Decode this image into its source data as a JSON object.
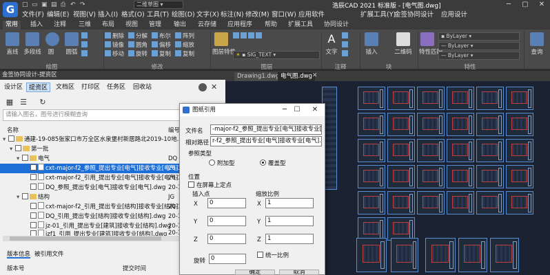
{
  "app": {
    "title": "浩辰CAD 2021 标准版 - [电气图.dwg]",
    "workspace": "二维草图",
    "brand_color": "#2f6fd0",
    "menu": [
      "文件(F)",
      "编辑(E)",
      "视图(V)",
      "插入(I)",
      "格式(O)",
      "工具(T)",
      "绘图(D)",
      "文字(X)",
      "标注(N)",
      "修改(M)",
      "窗口(W)",
      "应用软件",
      "扩展工具(Y)",
      "金签协同设计",
      "应用设计"
    ]
  },
  "ribbon": {
    "tabs": [
      "常用",
      "插入",
      "注释",
      "三维",
      "布局",
      "视图",
      "管理",
      "输出",
      "云存储",
      "应用程序",
      "帮助",
      "扩展工具",
      "协同设计"
    ],
    "draw": {
      "line": "直线",
      "polyline": "多段线",
      "circle": "圆",
      "arc": "圆弧",
      "group": "绘图"
    },
    "modify": {
      "delete": "删除",
      "explode": "分解",
      "boolean": "布尔",
      "copy": "复制",
      "mirror": "镜像",
      "fillet": "圆角",
      "offset": "偏移",
      "array": "阵列",
      "scale": "缩放",
      "move": "移动",
      "rotate": "旋转",
      "stretch": "复制",
      "group": "修改"
    },
    "layer": {
      "props": "图层特性",
      "name": "SIG_TEXT",
      "group": "图层"
    },
    "annotation": {
      "text": "文字",
      "group": "注释"
    },
    "block": {
      "insert": "插入",
      "qrcode": "二维码",
      "group": "块"
    },
    "properties": {
      "match": "特性匹配",
      "bylayer1": "ByLayer",
      "bylayer2": "ByLayer",
      "bylayer3": "ByLayer",
      "group": "特性"
    },
    "utilities": {
      "query": "查询"
    }
  },
  "left_panel": {
    "title": "金签协同设计-提资区",
    "tabs": [
      "设计区",
      "提资区",
      "文档区",
      "打印区",
      "任务区",
      "回收站"
    ],
    "active_tab": "提资区",
    "search_placeholder": "请输入图名，图号进行模糊查询",
    "col_name": "名称",
    "col_num": "编号",
    "tree": [
      {
        "label": "通建-19-085张家口市万全区水泉堡村新居路北2019-10地...",
        "num": "",
        "level": 0
      },
      {
        "label": "第一批",
        "num": "",
        "level": 1
      },
      {
        "label": "电气",
        "num": "DQ",
        "level": 2
      },
      {
        "label": "cxt-major-f2_参照_提出专业[电气]接收专业[电气]",
        "num": "20-1",
        "level": 3,
        "selected": true
      },
      {
        "label": "cxt-major-f2_引用_提出专业[电气]接收专业[电气]",
        "num": "20-1",
        "level": 3
      },
      {
        "label": "DQ_参照_提出专业[电气]接收专业[电气].dwg",
        "num": "20-1",
        "level": 3
      },
      {
        "label": "结构",
        "num": "JG",
        "level": 2
      },
      {
        "label": "cxt-major-f2_引用_提出专业[结构]接收专业[结构]",
        "num": "20-1",
        "level": 3
      },
      {
        "label": "DQ_引用_提出专业[结构]接收专业[结构].dwg",
        "num": "20-1",
        "level": 3
      },
      {
        "label": "jz-01_引用_提出专业[建筑]接收专业[结构].dwg",
        "num": "20-1",
        "level": 3
      },
      {
        "label": "jzf1_引用_提出专业[建筑]接收专业[结构].dwg",
        "num": "20-1",
        "level": 3
      }
    ],
    "bottom_tabs": [
      "版本信息",
      "被引用文件"
    ],
    "col_version": "版本号",
    "col_time": "提交时间"
  },
  "drawing_tabs": [
    "Drawing1.dwg",
    "电气图.dwg"
  ],
  "dialog": {
    "title": "图纸引用",
    "filename_label": "文件名",
    "filename_value": "-major-f2_参照_提出专业[电气]接收专业[电气",
    "relpath_label": "相对路径",
    "relpath_value": "r-f2_参照_提出专业[电气]接收专业[电气].dwg",
    "ref_type_label": "参照类型",
    "attach": "附加型",
    "overlay": "覆盖型",
    "position_label": "位置",
    "onscreen": "在屏幕上定点",
    "insert_point_label": "插入点",
    "scale_label": "缩放比例",
    "x_label": "X",
    "y_label": "Y",
    "z_label": "Z",
    "x_val": "0",
    "y_val": "0",
    "z_val": "0",
    "sx_val": "1",
    "sy_val": "1",
    "sz_val": "1",
    "rotate_label": "旋转",
    "rotate_val": "0",
    "uniform": "统一比例",
    "ok": "确定",
    "cancel": "取消"
  }
}
